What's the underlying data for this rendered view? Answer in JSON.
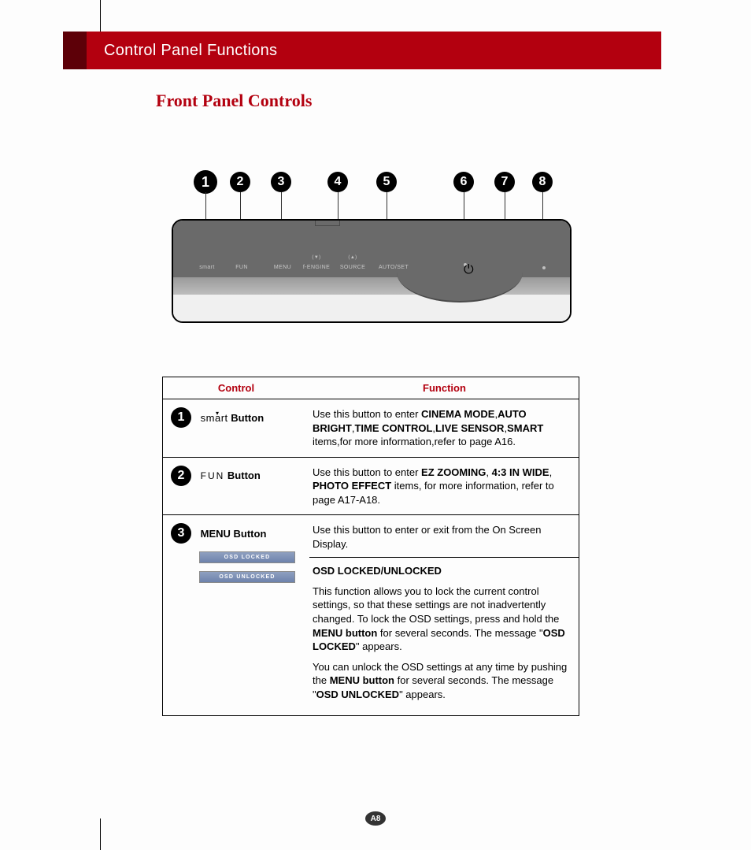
{
  "header": {
    "title": "Control Panel Functions"
  },
  "section_title": "Front Panel Controls",
  "diagram": {
    "callouts": [
      "1",
      "2",
      "3",
      "4",
      "5",
      "6",
      "7",
      "8"
    ],
    "labels": [
      "smart",
      "FUN",
      "MENU",
      "f-ENGINE",
      "SOURCE",
      "AUTO/SET"
    ],
    "sub4": "(▼)",
    "sub5": "(▲)"
  },
  "table": {
    "head_control": "Control",
    "head_function": "Function",
    "rows": [
      {
        "num": "1",
        "ctrl_pre": "sm",
        "ctrl_mid": "a",
        "ctrl_post": "rt",
        "ctrl_suffix": " Button",
        "func_pre": "Use this button to enter ",
        "bold1": "CINEMA MODE",
        "sep1": ",",
        "bold2": "AUTO BRIGHT",
        "sep2": ",",
        "bold3": "TIME CONTROL",
        "sep3": ",",
        "bold4": "LIVE SENSOR",
        "sep4": ",",
        "bold5": "SMART",
        "post": " items,for more information,refer to page A16."
      },
      {
        "num": "2",
        "ctrl_label": "FUN",
        "ctrl_suffix": "  Button",
        "func_pre": "Use this button to enter ",
        "bold1": "EZ ZOOMING",
        "sep1": ", ",
        "bold2": "4:3 IN WIDE",
        "sep2": ", ",
        "bold3": "PHOTO EFFECT",
        "post": " items, for more information, refer to page A17-A18."
      },
      {
        "num": "3",
        "ctrl_label": "MENU Button",
        "osd_locked": "OSD LOCKED",
        "osd_unlocked": "OSD UNLOCKED",
        "line1": "Use this button to enter or exit from the On Screen Display.",
        "heading": "OSD LOCKED/UNLOCKED",
        "p2_a": "This function allows you to lock the current control settings, so that these settings are not inadvertently changed. To lock the OSD settings, press and hold the ",
        "p2_b": "MENU button",
        "p2_c": " for several seconds. The message \"",
        "p2_d": "OSD LOCKED",
        "p2_e": "\" appears.",
        "p3_a": "You can unlock the OSD settings at any time by pushing the ",
        "p3_b": "MENU button",
        "p3_c": " for several seconds. The message \"",
        "p3_d": "OSD UNLOCKED",
        "p3_e": "\" appears."
      }
    ]
  },
  "page_number": "A8"
}
